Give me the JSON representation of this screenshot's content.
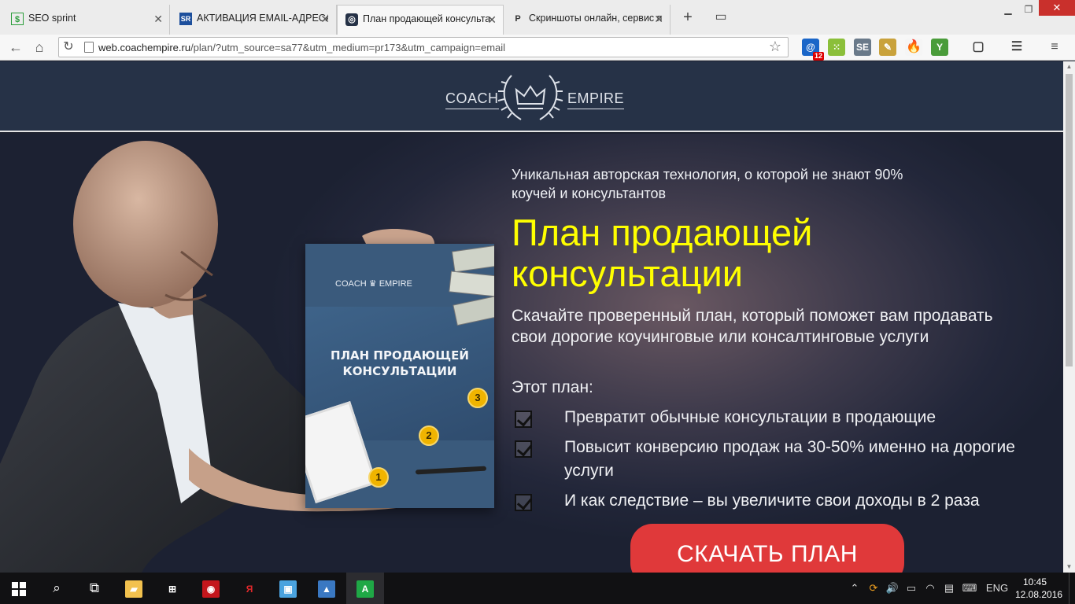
{
  "browser": {
    "tabs": [
      {
        "label": "SEO sprint",
        "favicon": "$"
      },
      {
        "label": "АКТИВАЦИЯ EMAIL-АДРЕСА В",
        "favicon": "SR"
      },
      {
        "label": "План продающей консульта",
        "favicon": "◎"
      },
      {
        "label": "Скриншоты онлайн, сервис по",
        "favicon": "P"
      }
    ],
    "new_tab": "+",
    "tab_menu": "▭",
    "url_host": "web.coachempire.ru",
    "url_path": "/plan/?utm_source=sa77&utm_medium=pr173&utm_campaign=email",
    "extensions": [
      {
        "name": "mail-icon",
        "glyph": "@",
        "badge": "12",
        "color": "#1a66c8"
      },
      {
        "name": "dots-icon",
        "glyph": "⁙",
        "color": "#8bbf3a"
      },
      {
        "name": "seo-icon",
        "glyph": "SE",
        "color": "#6a7a8a"
      },
      {
        "name": "note-icon",
        "glyph": "✎",
        "color": "#c9a23c"
      },
      {
        "name": "flame-icon",
        "glyph": "🔥",
        "color": "#f5f5f5"
      },
      {
        "name": "sprout-icon",
        "glyph": "Y",
        "color": "#4a9c3a"
      },
      {
        "name": "chat-icon",
        "glyph": "▢",
        "color": "#f7f7f7"
      },
      {
        "name": "reader-icon",
        "glyph": "☰",
        "color": "#f7f7f7"
      },
      {
        "name": "menu-icon",
        "glyph": "≡",
        "color": "#f7f7f7"
      }
    ]
  },
  "site": {
    "logo_left": "COACH",
    "logo_right": "EMPIRE",
    "intro": "Уникальная авторская технология, о которой не знают 90% коучей и консультантов",
    "headline": "План продающей консультации",
    "subtext": "Скачайте проверенный план, который поможет вам продавать свои дорогие коучинговые или консалтинговые услуги",
    "list_heading": "Этот план:",
    "bullets": [
      "Превратит обычные консультации в продающие",
      "Повысит конверсию продаж на 30-50% именно на дорогие услуги",
      "И как следствие – вы увеличите свои доходы в 2 раза"
    ],
    "cta": "СКАЧАТЬ ПЛАН",
    "booklet": {
      "logo_left": "COACH",
      "logo_right": "EMPIRE",
      "title": "ПЛАН ПРОДАЮЩЕЙ КОНСУЛЬТАЦИИ",
      "steps": [
        "1",
        "2",
        "3"
      ]
    },
    "colors": {
      "header": "#263247",
      "headline": "#ffff00",
      "cta": "#e0393a"
    }
  },
  "taskbar": {
    "language": "ENG",
    "time": "10:45",
    "date": "12.08.2016",
    "pinned": [
      {
        "name": "file-explorer-icon",
        "glyph": "▰",
        "color": "#f2c14e"
      },
      {
        "name": "store-icon",
        "glyph": "⊞",
        "color": "#ffffff"
      },
      {
        "name": "opera-icon",
        "glyph": "◉",
        "color": "#c4161c"
      },
      {
        "name": "yandex-browser-icon",
        "glyph": "Я",
        "color": "#ffffff"
      },
      {
        "name": "chat-app-icon",
        "glyph": "▣",
        "color": "#4aa3df"
      },
      {
        "name": "screen-app-icon",
        "glyph": "▲",
        "color": "#3a78c2"
      },
      {
        "name": "android-app-icon",
        "glyph": "A",
        "color": "#1fa846"
      }
    ]
  }
}
